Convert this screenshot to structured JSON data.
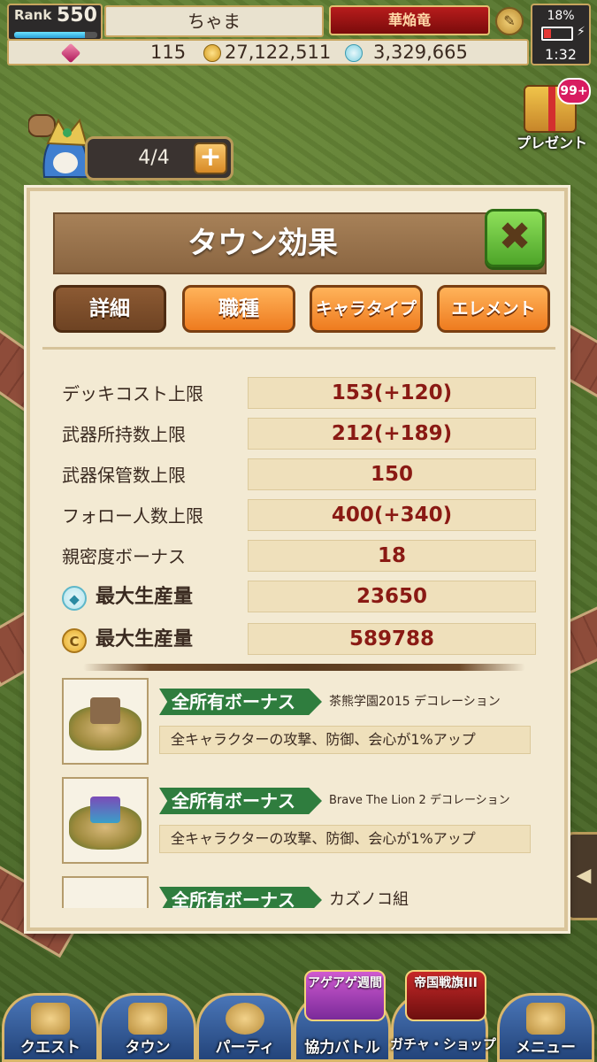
{
  "hud": {
    "rank_label": "Rank",
    "rank_value": "550",
    "rank_progress": 0.85,
    "player_name": "ちゃま",
    "title_badge": "華焔竜",
    "battery_percent": "18%",
    "clock": "1:32",
    "gems": "115",
    "coins": "27,122,511",
    "water": "3,329,665"
  },
  "stamina": {
    "value": "4/4",
    "plus_label": "+"
  },
  "present": {
    "badge": "99+",
    "label": "プレゼント"
  },
  "modal": {
    "title": "タウン効果",
    "close_label": "✖",
    "tabs": [
      {
        "label": "詳細",
        "active": true
      },
      {
        "label": "職種",
        "active": false
      },
      {
        "label": "キャラタイプ",
        "active": false
      },
      {
        "label": "エレメント",
        "active": false
      }
    ],
    "stats": [
      {
        "label": "デッキコスト上限",
        "value": "153(+120)"
      },
      {
        "label": "武器所持数上限",
        "value": "212(+189)"
      },
      {
        "label": "武器保管数上限",
        "value": "150"
      },
      {
        "label": "フォロー人数上限",
        "value": "400(+340)"
      },
      {
        "label": "親密度ボーナス",
        "value": "18"
      },
      {
        "label": "最大生産量",
        "value": "23650",
        "icon": "water-drop-icon"
      },
      {
        "label": "最大生産量",
        "value": "589788",
        "icon": "coin-icon"
      }
    ],
    "bonuses": [
      {
        "tag": "全所有ボーナス",
        "title": "茶熊学園2015 デコレーション",
        "description": "全キャラクターの攻撃、防御、会心が1%アップ"
      },
      {
        "tag": "全所有ボーナス",
        "title": "Brave The Lion 2 デコレーション",
        "description": "全キャラクターの攻撃、防御、会心が1%アップ"
      },
      {
        "tag": "全所有ボーナス",
        "title": "カズノコ組",
        "description": ""
      }
    ]
  },
  "bottom_nav": [
    {
      "label": "クエスト",
      "icon": "map-icon"
    },
    {
      "label": "タウン",
      "icon": "town-icon"
    },
    {
      "label": "パーティ",
      "icon": "party-icon"
    },
    {
      "label": "協力バトル",
      "icon": "coop-battle-icon"
    },
    {
      "label": "ガチャ・ショップ",
      "icon": "gacha-icon"
    },
    {
      "label": "メニュー",
      "icon": "menu-scroll-icon"
    }
  ],
  "event_badges": [
    {
      "label": "アゲアゲ週間"
    },
    {
      "label": "帝国戦旗III"
    }
  ],
  "colors": {
    "value_text": "#8a1a14",
    "tab_active": "#7a4a28",
    "tab_inactive": "#f28a2a",
    "bonus_tag": "#2f7d3e",
    "close_button": "#5cb335"
  }
}
